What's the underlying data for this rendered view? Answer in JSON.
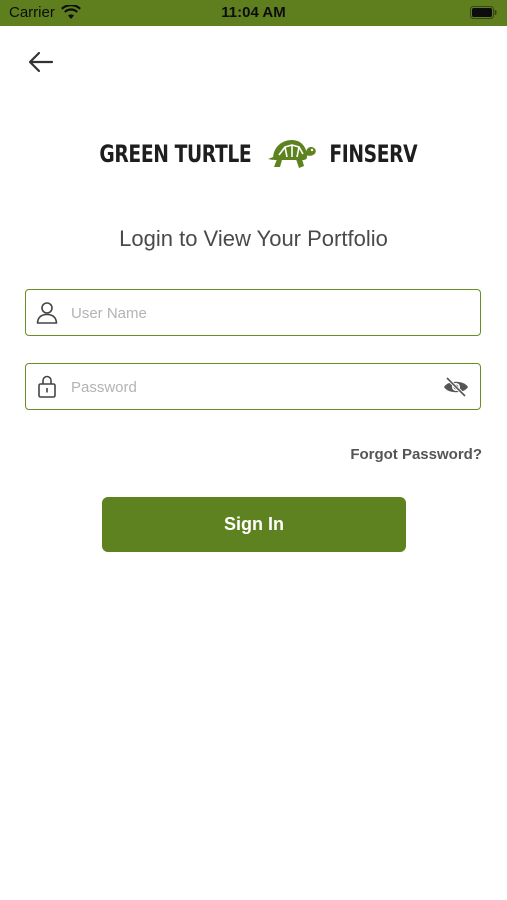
{
  "status_bar": {
    "carrier": "Carrier",
    "time": "11:04 AM",
    "icons": [
      "wifi-icon",
      "battery-icon"
    ],
    "background_color": "#5f7f1e"
  },
  "nav": {
    "back_icon": "arrow-left-icon"
  },
  "brand": {
    "left_text": "GREEN TURTLE",
    "right_text": "FINSERV",
    "logo_icon": "turtle-icon",
    "accent_color": "#5f8220"
  },
  "heading": "Login to View Your Portfolio",
  "form": {
    "username": {
      "placeholder": "User Name",
      "value": "",
      "icon": "user-icon"
    },
    "password": {
      "placeholder": "Password",
      "value": "",
      "icon": "lock-icon",
      "toggle_icon": "eye-slash-icon"
    },
    "forgot_label": "Forgot Password?",
    "signin_label": "Sign In"
  }
}
